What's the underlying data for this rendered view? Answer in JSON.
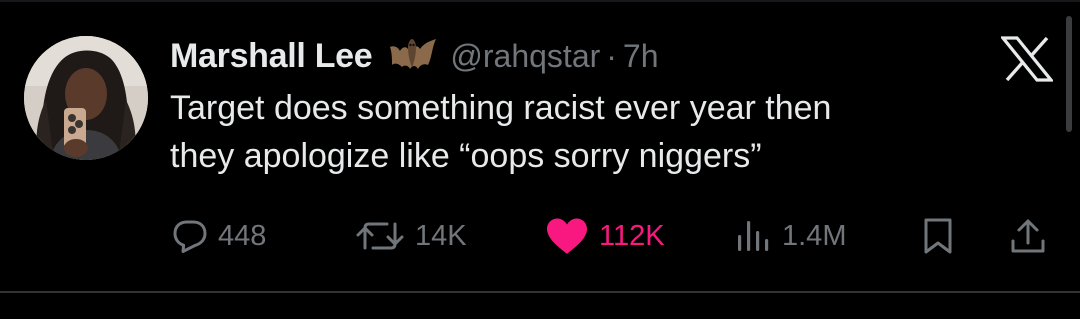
{
  "tweet": {
    "author": {
      "display_name": "Marshall Lee",
      "emoji_icon": "bat-emoji",
      "handle": "@rahqstar",
      "separator": "·",
      "time_ago": "7h"
    },
    "text_lines": [
      "Target does something racist ever year then",
      "they apologize like “oops sorry niggers”"
    ],
    "actions": {
      "replies": "448",
      "reposts": "14K",
      "likes": "112K",
      "views": "1.4M"
    },
    "liked": true
  },
  "colors": {
    "background": "#000000",
    "primary_text": "#e7e9ea",
    "secondary_text": "#71767b",
    "like_pink": "#f91880",
    "divider": "#2f3336"
  },
  "icons": [
    "avatar",
    "bat-emoji",
    "x-logo-icon",
    "reply-icon",
    "repost-icon",
    "like-heart-icon",
    "views-icon",
    "bookmark-icon",
    "share-icon"
  ]
}
